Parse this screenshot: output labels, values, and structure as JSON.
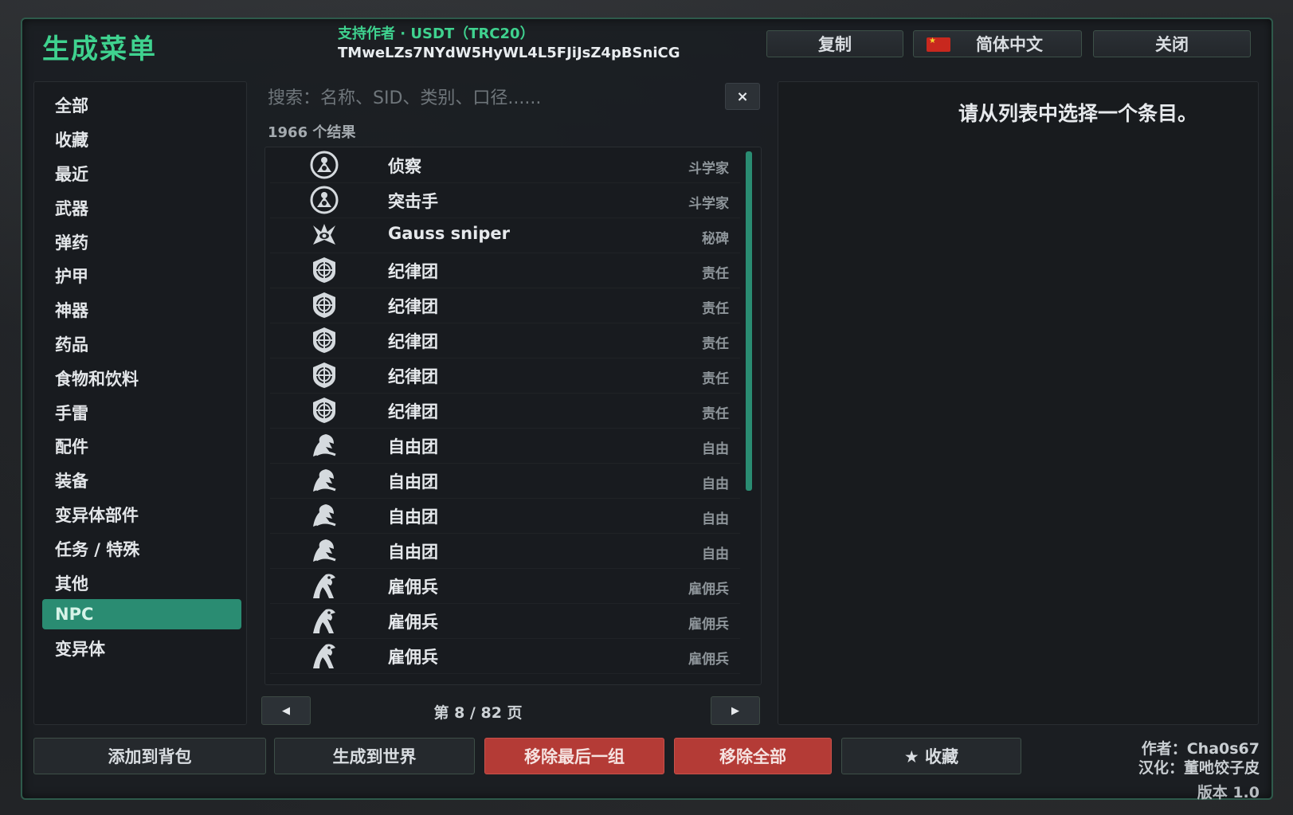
{
  "window": {
    "title": "生成菜单",
    "support_line1": "支持作者 · USDT（TRC20）",
    "support_line2": "TMweLZs7NYdW5HyWL4L5FJiJsZ4pBSniCG"
  },
  "header_buttons": {
    "copy": "复制",
    "language": "简体中文",
    "close": "关闭"
  },
  "categories": [
    {
      "label": "全部"
    },
    {
      "label": "收藏"
    },
    {
      "label": "最近"
    },
    {
      "label": "武器"
    },
    {
      "label": "弹药"
    },
    {
      "label": "护甲"
    },
    {
      "label": "神器"
    },
    {
      "label": "药品"
    },
    {
      "label": "食物和饮料"
    },
    {
      "label": "手雷"
    },
    {
      "label": "配件"
    },
    {
      "label": "装备"
    },
    {
      "label": "变异体部件"
    },
    {
      "label": "任务 / 特殊"
    },
    {
      "label": "其他"
    },
    {
      "label": "NPC"
    },
    {
      "label": "变异体"
    }
  ],
  "active_category": "NPC",
  "search": {
    "placeholder": "搜索：名称、SID、类别、口径......",
    "value": "",
    "clear_label": "×"
  },
  "result_count": "1966 个结果",
  "results": [
    {
      "name": "侦察",
      "faction": "斗学家",
      "icon": "scientist-icon"
    },
    {
      "name": "突击手",
      "faction": "斗学家",
      "icon": "scientist-icon"
    },
    {
      "name": "Gauss sniper",
      "faction": "秘碑",
      "icon": "monolith-icon"
    },
    {
      "name": "纪律团",
      "faction": "责任",
      "icon": "duty-icon"
    },
    {
      "name": "纪律团",
      "faction": "责任",
      "icon": "duty-icon"
    },
    {
      "name": "纪律团",
      "faction": "责任",
      "icon": "duty-icon"
    },
    {
      "name": "纪律团",
      "faction": "责任",
      "icon": "duty-icon"
    },
    {
      "name": "纪律团",
      "faction": "责任",
      "icon": "duty-icon"
    },
    {
      "name": "自由团",
      "faction": "自由",
      "icon": "freedom-icon"
    },
    {
      "name": "自由团",
      "faction": "自由",
      "icon": "freedom-icon"
    },
    {
      "name": "自由团",
      "faction": "自由",
      "icon": "freedom-icon"
    },
    {
      "name": "自由团",
      "faction": "自由",
      "icon": "freedom-icon"
    },
    {
      "name": "雇佣兵",
      "faction": "雇佣兵",
      "icon": "mercenary-icon"
    },
    {
      "name": "雇佣兵",
      "faction": "雇佣兵",
      "icon": "mercenary-icon"
    },
    {
      "name": "雇佣兵",
      "faction": "雇佣兵",
      "icon": "mercenary-icon"
    }
  ],
  "pagination": {
    "prev": "◀",
    "next": "▶",
    "label": "第 8 / 82 页"
  },
  "detail": {
    "message": "请从列表中选择一个条目。"
  },
  "actions": {
    "add_to_backpack": "添加到背包",
    "spawn_to_world": "生成到世界",
    "remove_last_group": "移除最后一组",
    "remove_all": "移除全部",
    "favorite": "★ 收藏"
  },
  "credits": {
    "author": "作者：Cha0s67",
    "translator": "汉化：董吔饺子皮",
    "version": "版本 1.0"
  },
  "colors": {
    "accent": "#3fd28f",
    "active_tab": "#2a8c72",
    "danger": "#b43b36",
    "flag": "#c8281e"
  }
}
